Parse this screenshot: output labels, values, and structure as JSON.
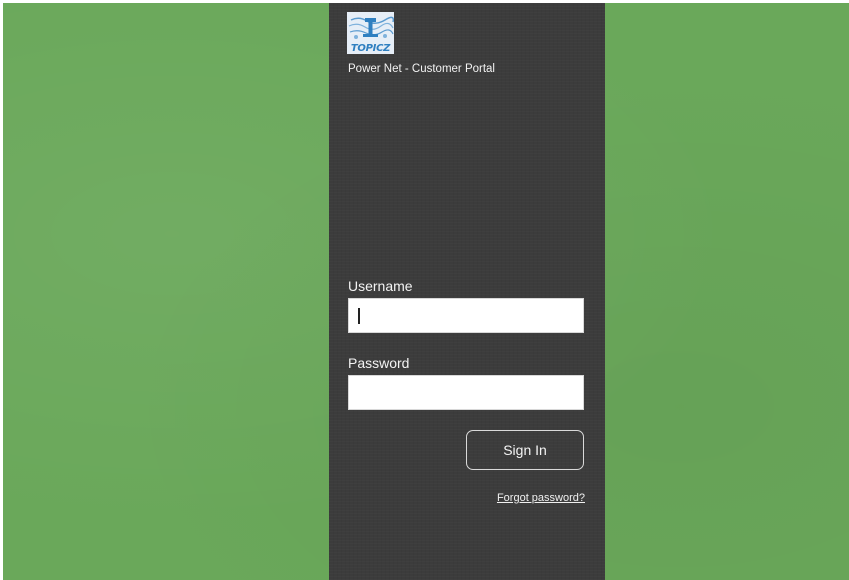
{
  "brand": {
    "logo_text": "TOPICZ",
    "portal_title": "Power Net - Customer Portal"
  },
  "form": {
    "username_label": "Username",
    "username_value": "",
    "password_label": "Password",
    "password_value": "",
    "signin_label": "Sign In",
    "forgot_label": "Forgot password?"
  },
  "colors": {
    "background": "#6aa85a",
    "panel": "#3c3c3c",
    "logo_blue": "#2f7fc0"
  },
  "icons": {
    "logo": "topicz-logo-icon"
  }
}
